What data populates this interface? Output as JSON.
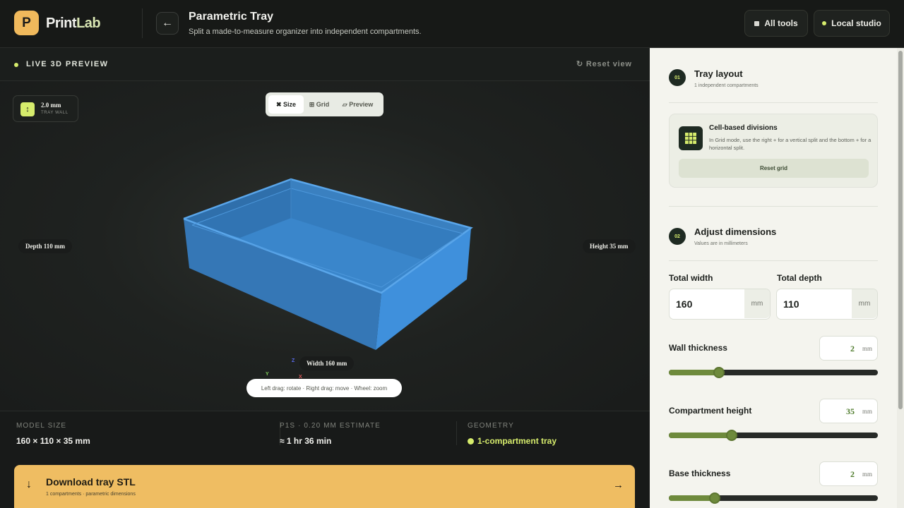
{
  "header": {
    "logo_letter": "P",
    "logo_print": "Print",
    "logo_lab": "Lab",
    "back_icon": "arrow-left-icon",
    "title": "Parametric Tray",
    "subtitle": "Split a made-to-measure organizer into independent compartments.",
    "all_tools_label": "All tools",
    "local_studio_label": "Local studio"
  },
  "viewer": {
    "live_label": "LIVE 3D PREVIEW",
    "reset_view_label": "↻ Reset view",
    "wall_value": "2.0 mm",
    "wall_label": "TRAY WALL",
    "modes": [
      {
        "label": "✖ Size",
        "active": true
      },
      {
        "label": "⊞ Grid",
        "active": false
      },
      {
        "label": "▱ Preview",
        "active": false
      }
    ],
    "depth_label": "Depth 110 mm",
    "height_label": "Height 35 mm",
    "width_label": "Width 160 mm",
    "axis_z": "Z",
    "axis_y": "Y",
    "axis_x": "X",
    "hint": "Left drag: rotate · Right drag: move · Wheel: zoom",
    "model_color": "#3d8fd6"
  },
  "stats": {
    "model_size_label": "MODEL SIZE",
    "model_size_value": "160 × 110 × 35 mm",
    "estimate_label": "P1S · 0.20 MM ESTIMATE",
    "estimate_value": "≈ 1 hr 36 min",
    "geometry_label": "GEOMETRY",
    "geometry_value": "1-compartment tray"
  },
  "download": {
    "title": "Download tray STL",
    "subtitle": "1 compartments · parametric dimensions",
    "icon": "arrow-down-icon",
    "right_icon": "arrow-right-icon"
  },
  "panel": {
    "step1_num": "01",
    "step1_title": "Tray layout",
    "step1_sub": "1 independent compartments",
    "cell_title": "Cell-based divisions",
    "cell_desc": "In Grid mode, use the right + for a vertical split and the bottom + for a horizontal split.",
    "reset_grid_label": "Reset grid",
    "step2_num": "02",
    "step2_title": "Adjust dimensions",
    "step2_sub": "Values are in millimeters",
    "total_width_label": "Total width",
    "total_width_value": "160",
    "total_depth_label": "Total depth",
    "total_depth_value": "110",
    "unit": "mm",
    "wall_thickness_label": "Wall thickness",
    "wall_thickness_value": "2",
    "wall_thickness_level": 0.24,
    "compartment_height_label": "Compartment height",
    "compartment_height_value": "35",
    "compartment_height_level": 0.3,
    "base_thickness_label": "Base thickness",
    "base_thickness_value": "2",
    "base_thickness_level": 0.22
  }
}
